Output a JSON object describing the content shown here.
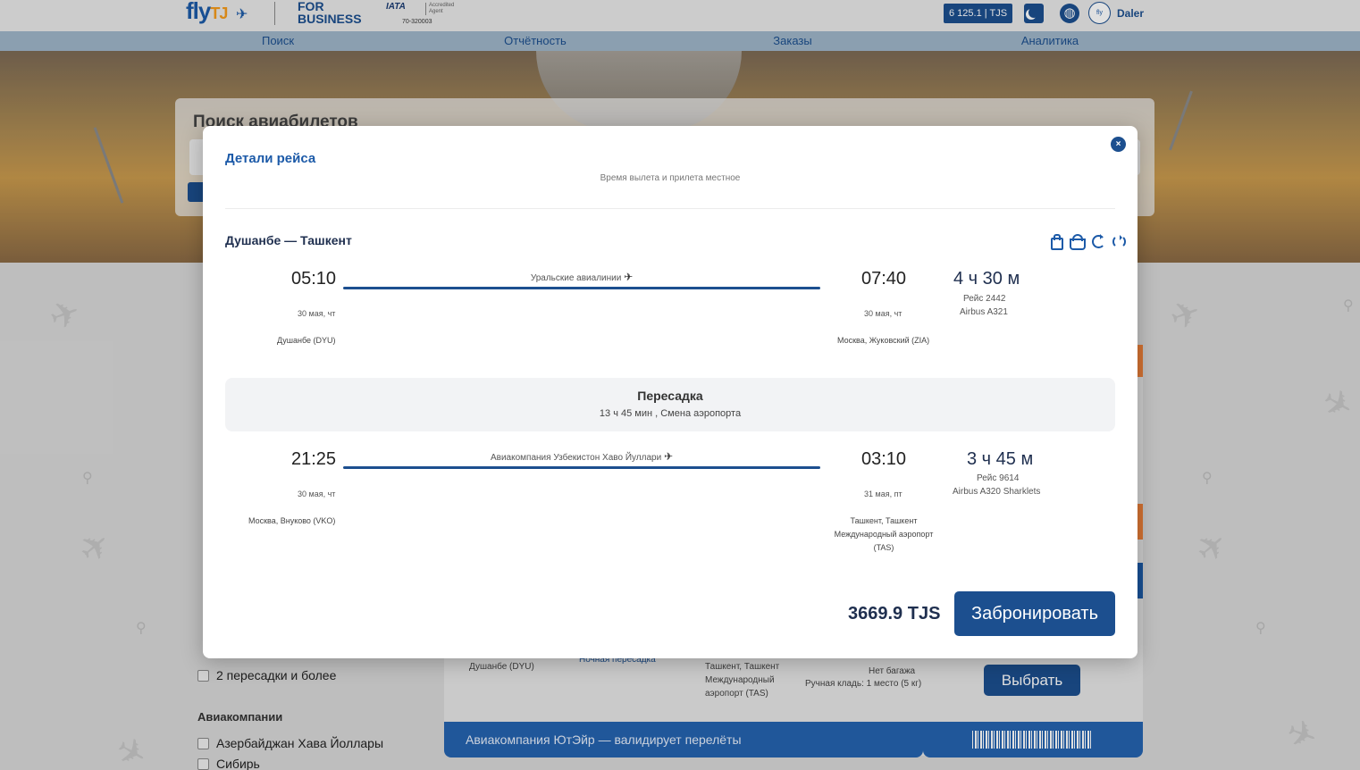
{
  "header": {
    "logo_text": "fly",
    "logo_tj": "TJ",
    "for_business_line1": "FOR",
    "for_business_line2": "BUSINESS",
    "iata_mark": "IATA",
    "iata_accredited": "Accredited Agent",
    "iata_number": "70-320003",
    "balance": "6 125.1 | TJS",
    "username": "Daler"
  },
  "nav": {
    "items": [
      {
        "label": "Поиск"
      },
      {
        "label": "Отчётность"
      },
      {
        "label": "Заказы"
      },
      {
        "label": "Аналитика"
      }
    ]
  },
  "search": {
    "title": "Поиск авиабилетов"
  },
  "filters": {
    "stops_option_3": "2 пересадки и более",
    "airlines_heading": "Авиакомпании",
    "airline_1": "Азербайджан Хава Йоллары",
    "airline_2": "Сибирь"
  },
  "background_card": {
    "from_place": "Душанбе (DYU)",
    "night_transfer": "Ночная пересадка",
    "to_place_line1": "Ташкент, Ташкент",
    "to_place_line2": "Международный",
    "to_place_line3": "аэропорт (TAS)",
    "baggage": "Нет багажа",
    "hand_luggage": "Ручная кладь: 1 место (5 кг)",
    "choose_button": "Выбрать",
    "validator": "Авиакомпания ЮтЭйр — валидирует перелёты"
  },
  "modal": {
    "title": "Детали рейса",
    "subtitle": "Время вылета и прилета местное",
    "close": "×",
    "route_title": "Душанбе — Ташкент",
    "segments": [
      {
        "airline": "Уральские авиалинии",
        "dep_time": "05:10",
        "dep_date": "30 мая, чт",
        "dep_place": "Душанбе (DYU)",
        "arr_time": "07:40",
        "arr_date": "30 мая, чт",
        "arr_place": "Москва, Жуковский (ZIA)",
        "duration": "4 ч 30 м",
        "flight": "Рейс 2442",
        "aircraft": "Airbus A321"
      },
      {
        "airline": "Авиакомпания Узбекистон Хаво Йуллари",
        "dep_time": "21:25",
        "dep_date": "30 мая, чт",
        "dep_place": "Москва, Внуково (VKO)",
        "arr_time": "03:10",
        "arr_date": "31 мая, пт",
        "arr_place_line1": "Ташкент, Ташкент",
        "arr_place_line2": "Международный аэропорт",
        "arr_place_line3": "(TAS)",
        "duration": "3 ч 45 м",
        "flight": "Рейс 9614",
        "aircraft": "Airbus A320 Sharklets"
      }
    ],
    "transfer": {
      "title": "Пересадка",
      "details": "13 ч 45 мин , Смена аэропорта"
    },
    "price": "3669.9 TJS",
    "book_button": "Забронировать"
  },
  "icons": {
    "bag": "bag-icon",
    "basket": "basket-icon",
    "refresh": "refresh-icon",
    "sync": "sync-icon",
    "plane": "plane-icon"
  },
  "colors": {
    "brand_blue": "#1c4f8f",
    "accent_orange": "#f0813a"
  }
}
